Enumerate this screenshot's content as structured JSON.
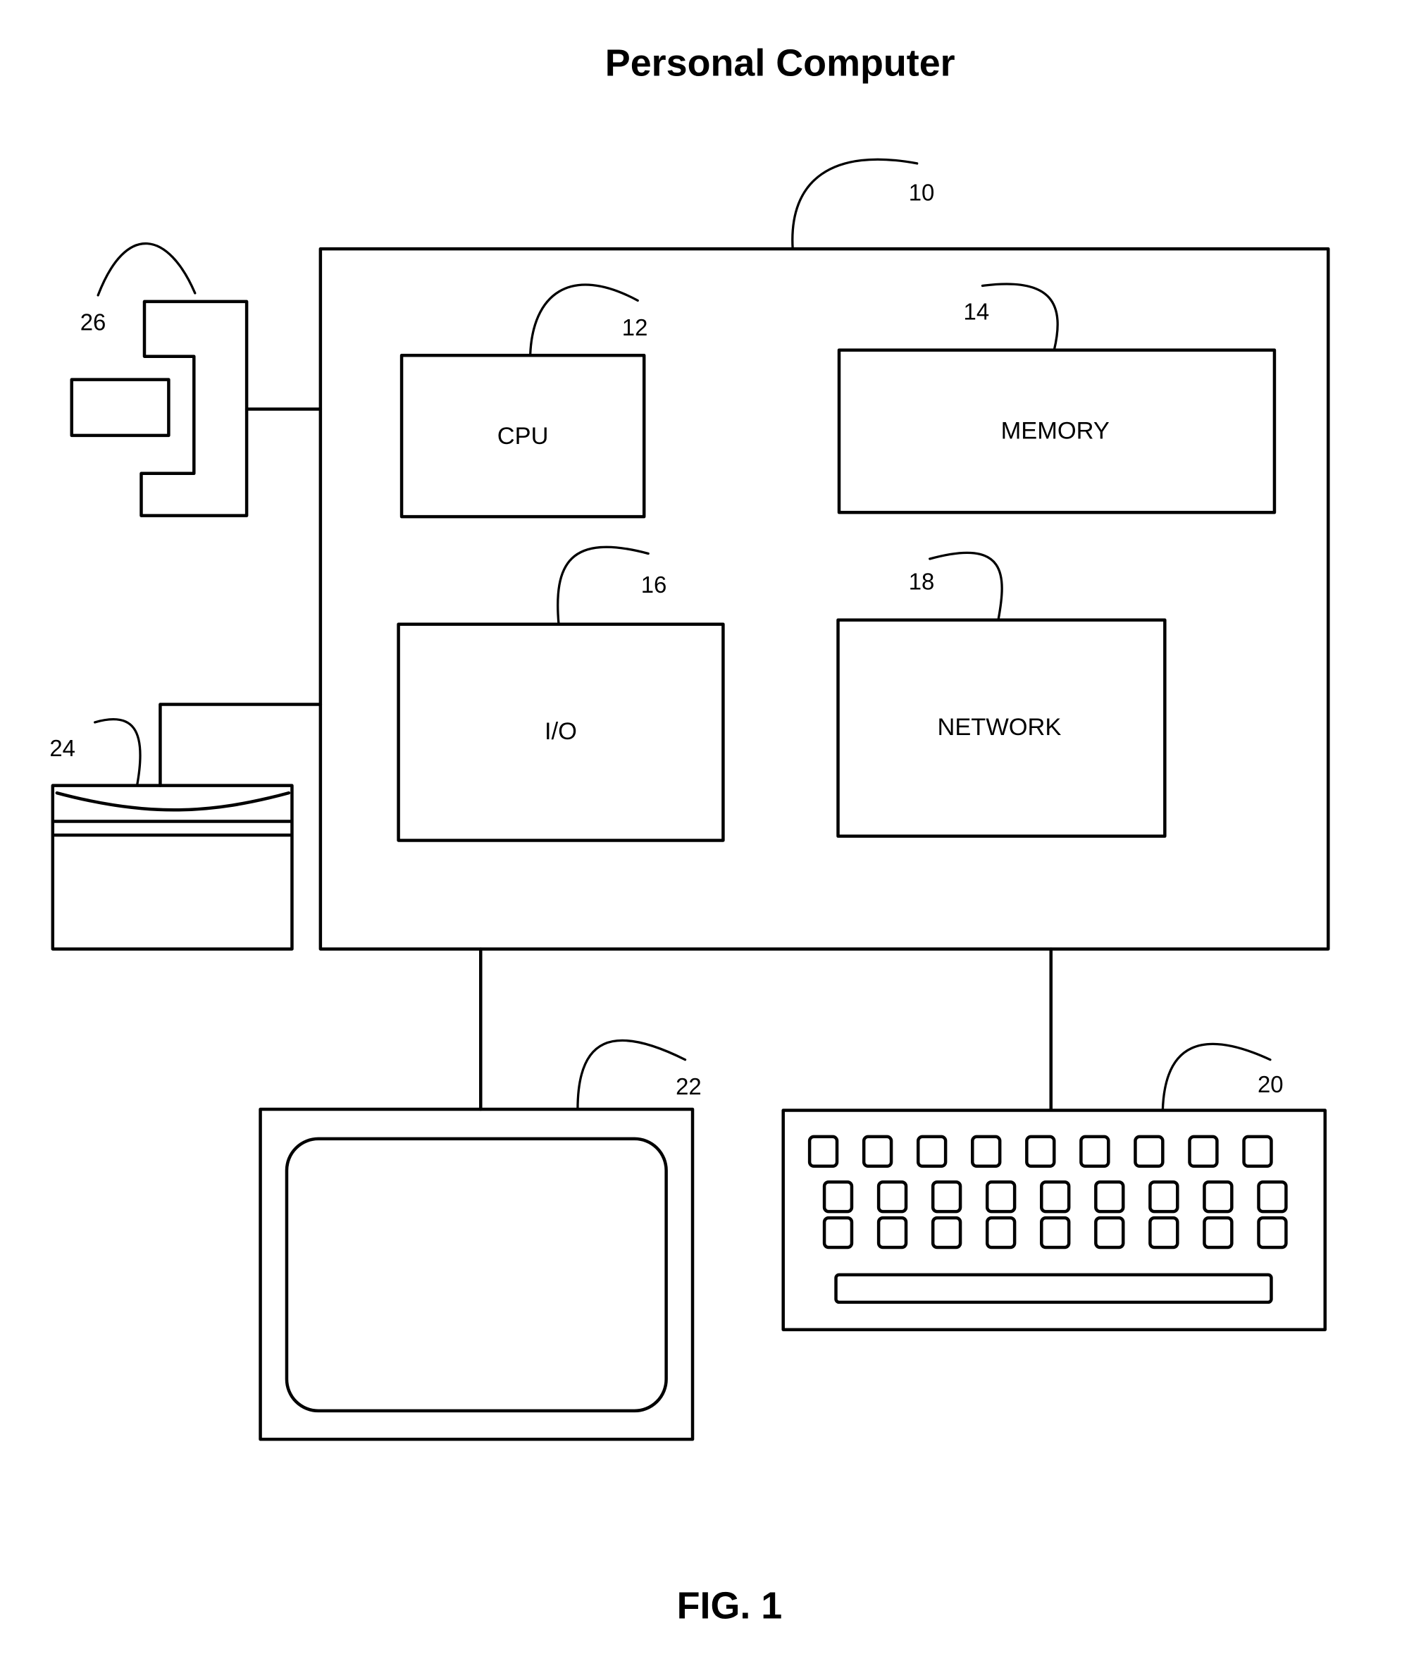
{
  "title": "Personal Computer",
  "figure_label": "FIG. 1",
  "components": {
    "computer": {
      "ref": "10"
    },
    "cpu": {
      "label": "CPU",
      "ref": "12"
    },
    "memory": {
      "label": "MEMORY",
      "ref": "14"
    },
    "io": {
      "label": "I/O",
      "ref": "16"
    },
    "network": {
      "label": "NETWORK",
      "ref": "18"
    },
    "keyboard": {
      "ref": "20",
      "key_rows": 3,
      "keys_per_row": 9
    },
    "monitor": {
      "ref": "22"
    },
    "disk_drive": {
      "ref": "24"
    },
    "media_reader": {
      "ref": "26"
    }
  }
}
